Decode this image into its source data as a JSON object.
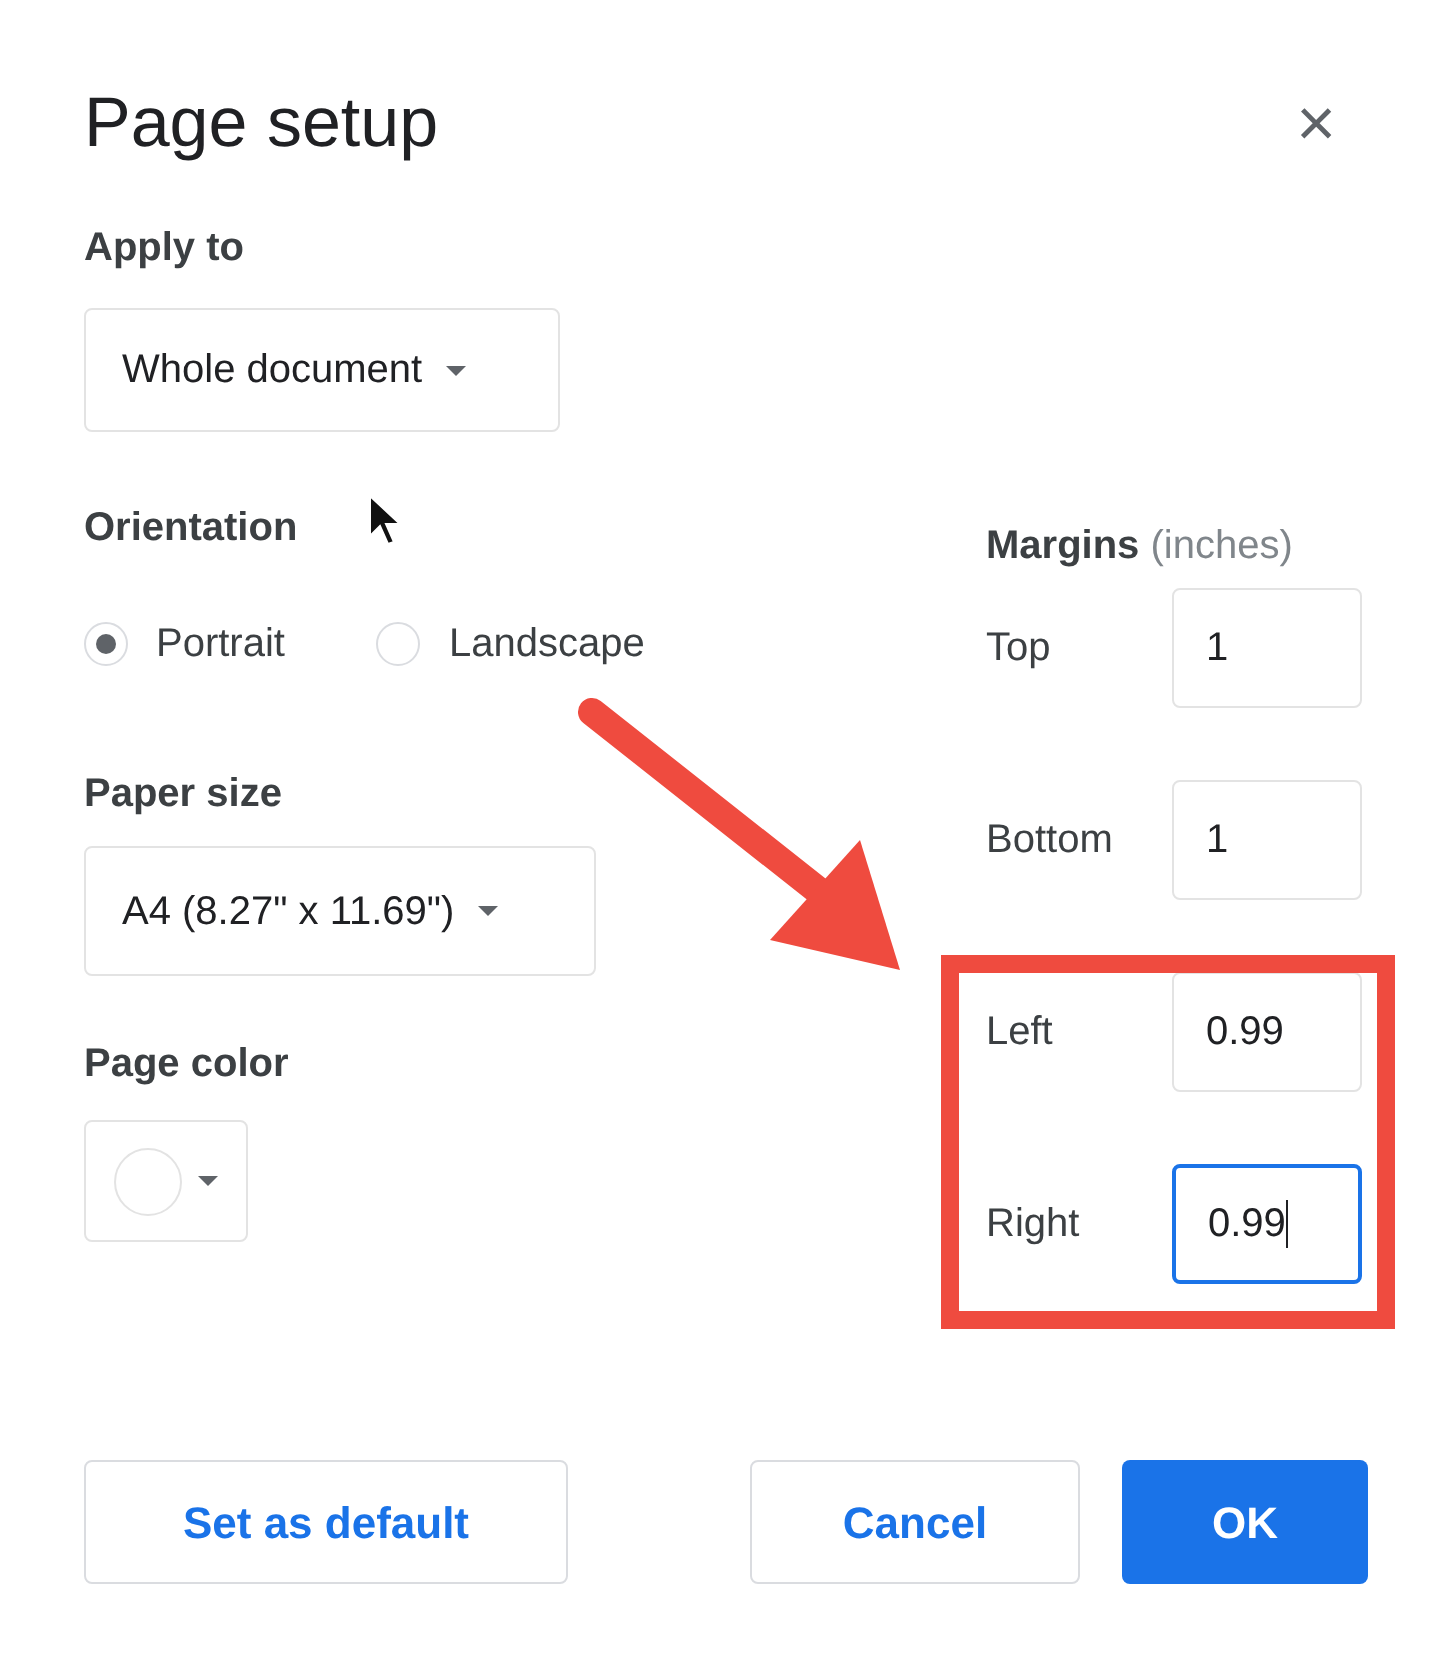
{
  "title": "Page setup",
  "close_label": "×",
  "apply_to": {
    "label": "Apply to",
    "value": "Whole document"
  },
  "orientation": {
    "label": "Orientation",
    "options": [
      {
        "label": "Portrait",
        "selected": true
      },
      {
        "label": "Landscape",
        "selected": false
      }
    ]
  },
  "paper_size": {
    "label": "Paper size",
    "value": "A4 (8.27\" x 11.69\")"
  },
  "page_color": {
    "label": "Page color",
    "color": "#ffffff"
  },
  "margins": {
    "label": "Margins",
    "unit": "(inches)",
    "fields": [
      {
        "label": "Top",
        "value": "1",
        "focused": false
      },
      {
        "label": "Bottom",
        "value": "1",
        "focused": false
      },
      {
        "label": "Left",
        "value": "0.99",
        "focused": false
      },
      {
        "label": "Right",
        "value": "0.99",
        "focused": true
      }
    ]
  },
  "buttons": [
    {
      "label": "Set as default",
      "kind": "outline"
    },
    {
      "label": "Cancel",
      "kind": "outline"
    },
    {
      "label": "OK",
      "kind": "primary"
    }
  ]
}
